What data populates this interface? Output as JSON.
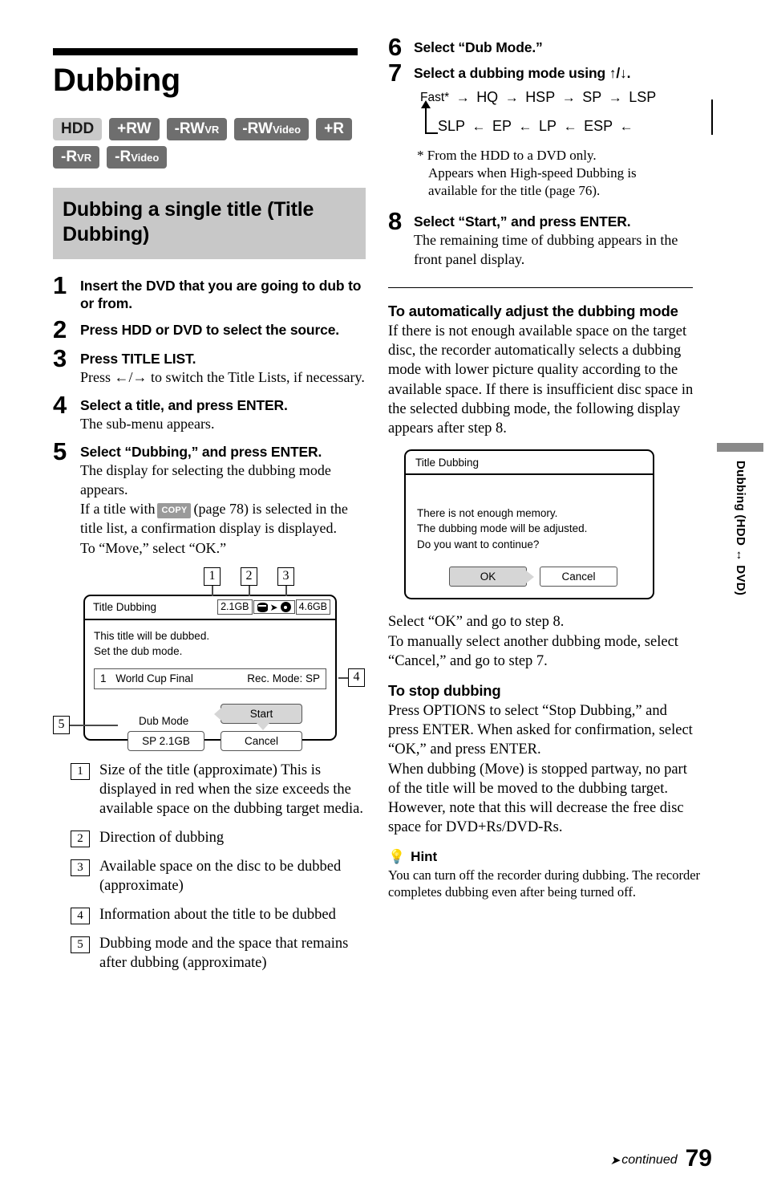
{
  "chapter": {
    "title": "Dubbing",
    "media_badges": [
      {
        "label": "HDD",
        "sub": "",
        "style": "light"
      },
      {
        "label": "+RW",
        "sub": "",
        "style": "dark"
      },
      {
        "label": "-RW",
        "sub": "VR",
        "style": "dark"
      },
      {
        "label": "-RW",
        "sub": "Video",
        "style": "dark"
      },
      {
        "label": "+R",
        "sub": "",
        "style": "dark"
      },
      {
        "label": "-R",
        "sub": "VR",
        "style": "dark"
      },
      {
        "label": "-R",
        "sub": "Video",
        "style": "dark"
      }
    ],
    "section_heading": "Dubbing a single title (Title Dubbing)"
  },
  "steps_left": [
    {
      "num": "1",
      "head": "Insert the DVD that you are going to dub to or from.",
      "body": []
    },
    {
      "num": "2",
      "head": "Press HDD or DVD to select the source.",
      "body": []
    },
    {
      "num": "3",
      "head": "Press TITLE LIST.",
      "body": [
        "Press ←/→ to switch the Title Lists, if necessary."
      ]
    },
    {
      "num": "4",
      "head": "Select a title, and press ENTER.",
      "body": [
        "The sub-menu appears."
      ]
    },
    {
      "num": "5",
      "head": "Select “Dubbing,” and press ENTER.",
      "body": [
        "The display for selecting the dubbing mode appears.",
        "If a title with  COPY  (page 78) is selected in the title list, a confirmation display is displayed.",
        "To “Move,” select “OK.”"
      ],
      "copy_chip_label": "COPY",
      "copy_line_a": "If a title with",
      "copy_line_b": "(page 78) is selected in the title list, a confirmation display is displayed.",
      "copy_line_c": "To “Move,” select “OK.”"
    }
  ],
  "screen_mock": {
    "title": "Title Dubbing",
    "source_size": "2.1GB",
    "target_size": "4.6GB",
    "direction_icon": "hdd-to-disc-arrow-icon",
    "message_line1": "This title will be dubbed.",
    "message_line2": "Set the dub mode.",
    "title_index": "1",
    "title_name": "World Cup Final",
    "rec_mode": "Rec. Mode:  SP",
    "dub_mode_label": "Dub Mode",
    "dub_mode_value": "SP 2.1GB",
    "start_label": "Start",
    "cancel_label": "Cancel",
    "callouts": [
      "1",
      "2",
      "3",
      "4",
      "5"
    ]
  },
  "legend": [
    {
      "num": "1",
      "text": "Size of the title (approximate) This is displayed in red when the size exceeds the available space on the dubbing target media."
    },
    {
      "num": "2",
      "text": "Direction of dubbing"
    },
    {
      "num": "3",
      "text": "Available space on the disc to be dubbed (approximate)"
    },
    {
      "num": "4",
      "text": "Information about the title to be dubbed"
    },
    {
      "num": "5",
      "text": "Dubbing mode and the space that remains after dubbing (approximate)"
    }
  ],
  "steps_right": [
    {
      "num": "6",
      "head": "Select “Dub Mode.”"
    },
    {
      "num": "7",
      "head": "Select a dubbing mode using ↑/↓."
    },
    {
      "num": "8",
      "head": "Select “Start,” and press ENTER.",
      "body": [
        "The remaining time of dubbing appears in the front panel display."
      ]
    }
  ],
  "dub_mode_flow": {
    "row1": [
      "Fast*",
      "HQ",
      "HSP",
      "SP",
      "LSP"
    ],
    "row2": [
      "SLP",
      "EP",
      "LP",
      "ESP"
    ],
    "arrow_right": "→",
    "arrow_left": "←"
  },
  "footnote": {
    "marker": "*",
    "line1": "From the HDD to a DVD only.",
    "line2": "Appears when High-speed Dubbing is",
    "line3": "available for the title (page 76)."
  },
  "auto_adjust": {
    "heading": "To automatically adjust the dubbing mode",
    "body": "If there is not enough available space on the target disc, the recorder automatically selects a dubbing mode with lower picture quality according to the available space. If there is insufficient disc space in the selected dubbing mode, the following display appears after step 8."
  },
  "dialog_mock": {
    "title": "Title Dubbing",
    "msg_line1": "There is not enough memory.",
    "msg_line2": "The dubbing mode will be adjusted.",
    "msg_line3": "Do you want to continue?",
    "ok_label": "OK",
    "cancel_label": "Cancel"
  },
  "after_dialog": {
    "line1": "Select “OK” and go to step 8.",
    "line2": "To manually select another dubbing mode, select “Cancel,” and go to step 7."
  },
  "stop_dubbing": {
    "heading": "To stop dubbing",
    "para1": "Press OPTIONS to select “Stop Dubbing,” and press ENTER. When asked for confirmation, select “OK,” and press ENTER.",
    "para2": "When dubbing (Move) is stopped partway, no part of the title will be moved to the dubbing target. However, note that this will decrease the free disc space for DVD+Rs/DVD-Rs."
  },
  "hint": {
    "label": "Hint",
    "icon": "lightbulb-icon",
    "text": "You can turn off the recorder during dubbing. The recorder completes dubbing even after being turned off."
  },
  "side_tab": {
    "text": "Dubbing (HDD ↔ DVD)"
  },
  "footer": {
    "continued": "continued",
    "arrow": "→",
    "page_number": "79"
  }
}
